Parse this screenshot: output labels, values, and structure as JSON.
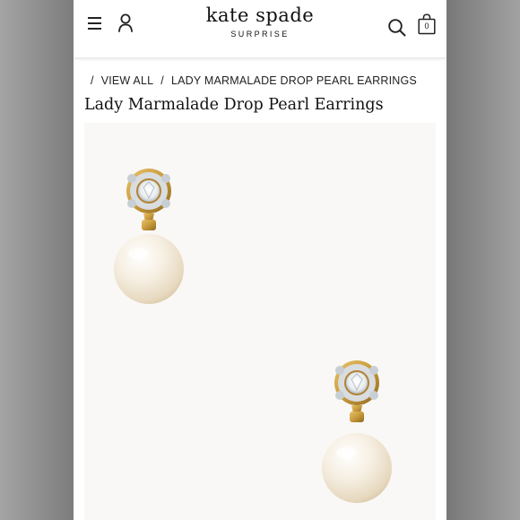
{
  "header": {
    "brand": "kate spade",
    "brand_sub": "SURPRISE",
    "bag_count": "0",
    "icons": [
      "menu-icon",
      "user-icon",
      "search-icon",
      "shopping-bag-icon"
    ]
  },
  "breadcrumb": {
    "separator": "/",
    "items": [
      "VIEW ALL",
      "LADY MARMALADE DROP PEARL EARRINGS"
    ]
  },
  "product": {
    "title": "Lady Marmalade Drop Pearl Earrings"
  },
  "colors": {
    "background_frame": "#8a8a8a",
    "page_background": "#ffffff",
    "image_background": "#f9f8f6",
    "gold": "#c99a3c",
    "pearl": "#f3ead9"
  }
}
